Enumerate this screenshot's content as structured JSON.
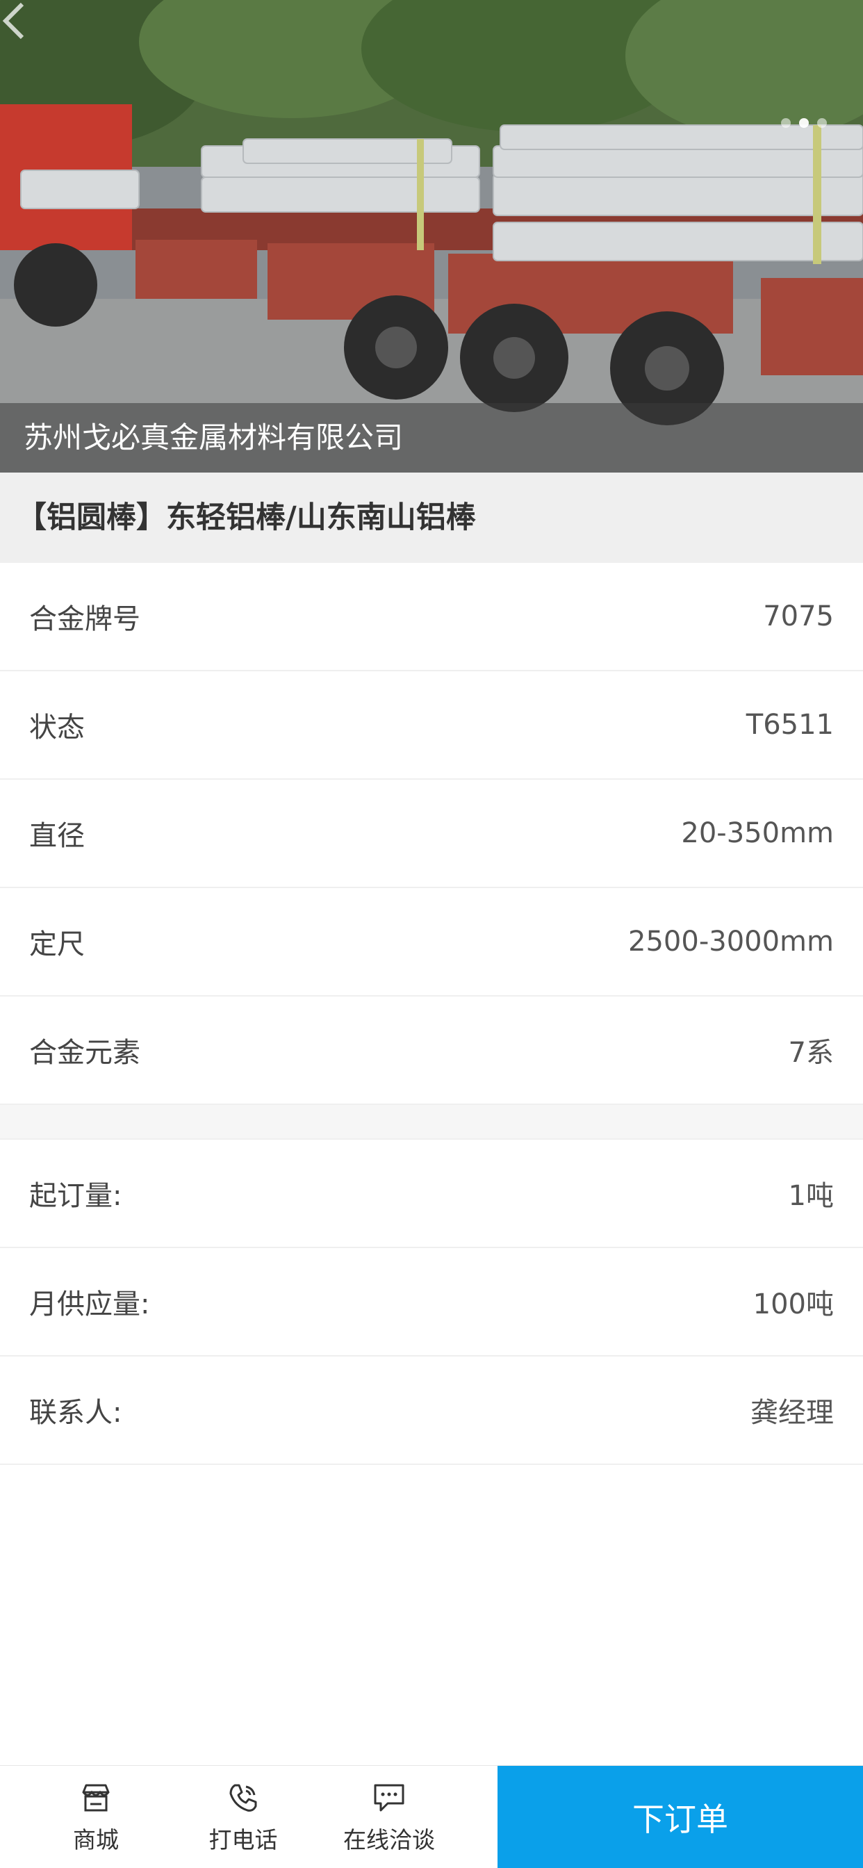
{
  "hero": {
    "company_name": "苏州戈必真金属材料有限公司",
    "slide_count": 3,
    "active_slide": 1,
    "image_subject": "truck loaded with aluminum rods"
  },
  "product": {
    "title": "【铝圆棒】东轻铝棒/山东南山铝棒"
  },
  "specs": [
    {
      "label": "合金牌号",
      "value": "7075"
    },
    {
      "label": "状态",
      "value": "T6511"
    },
    {
      "label": "直径",
      "value": "20-350mm"
    },
    {
      "label": "定尺",
      "value": "2500-3000mm"
    },
    {
      "label": "合金元素",
      "value": "7系"
    }
  ],
  "info": [
    {
      "label": "起订量:",
      "value": "1吨"
    },
    {
      "label": "月供应量:",
      "value": "100吨"
    },
    {
      "label": "联系人:",
      "value": "龚经理"
    }
  ],
  "bottom_bar": {
    "tabs": [
      {
        "label": "商城",
        "icon": "store-icon"
      },
      {
        "label": "打电话",
        "icon": "phone-icon"
      },
      {
        "label": "在线洽谈",
        "icon": "chat-icon"
      }
    ],
    "order_button": "下订单"
  },
  "colors": {
    "accent": "#0aa0ea",
    "title_band_bg": "#efefef",
    "divider": "#efefef"
  }
}
